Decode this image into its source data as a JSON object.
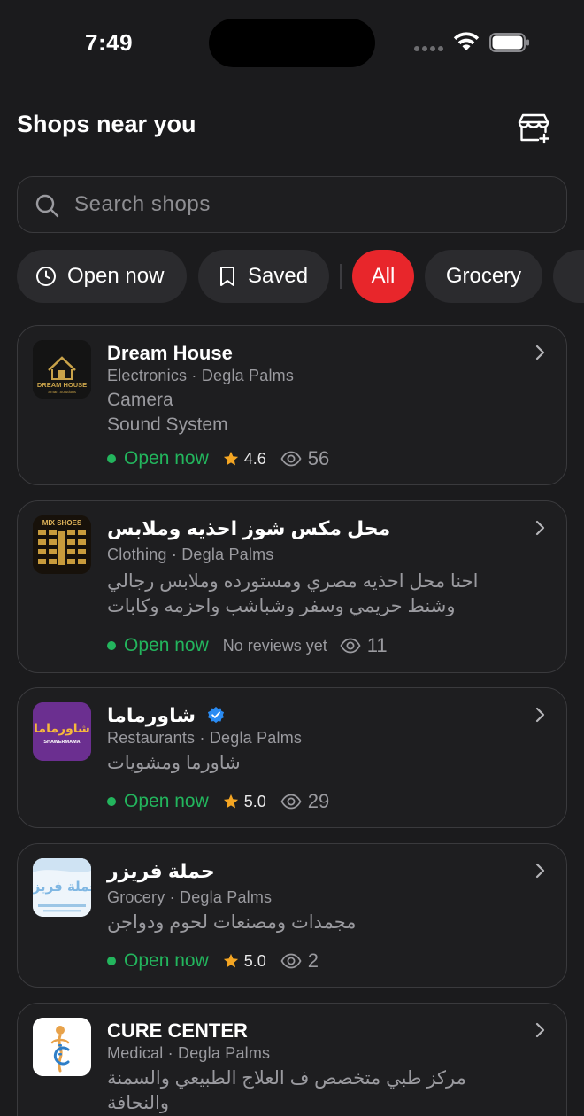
{
  "status": {
    "time": "7:49"
  },
  "header": {
    "title": "Shops near you",
    "add_icon": "store-plus-icon"
  },
  "search": {
    "placeholder": "Search shops",
    "value": ""
  },
  "filters": {
    "open_now": "Open now",
    "saved": "Saved",
    "all": "All",
    "grocery": "Grocery",
    "active": "All",
    "active_color": "#e8262b"
  },
  "shops": [
    {
      "name": "Dream House",
      "meta": "Electronics · Degla Palms",
      "desc": [
        "Camera",
        "Sound System"
      ],
      "status": "Open now",
      "rating": "4.6",
      "views": "56",
      "logo_text": "DREAM HOUSE",
      "logo_sub": "Smart Solutions"
    },
    {
      "name": "محل مكس شوز احذيه وملابس",
      "meta": "Clothing · Degla Palms",
      "desc": [
        "احنا محل احذيه مصري ومستورده وملابس رجالي",
        "وشنط حريمي وسفر وشباشب واحزمه وكابات"
      ],
      "status": "Open now",
      "rating_text": "No reviews yet",
      "views": "11",
      "logo_text": "MIX SHOES"
    },
    {
      "name": "شاورماما",
      "meta": "Restaurants · Degla Palms",
      "desc": [
        "شاورما ومشويات"
      ],
      "status": "Open now",
      "rating": "5.0",
      "views": "29",
      "verified": true,
      "logo_text": "شاورماما",
      "logo_sub": "SHAWERMAMA"
    },
    {
      "name": "حملة فريزر",
      "meta": "Grocery · Degla Palms",
      "desc": [
        "مجمدات ومصنعات لحوم ودواجن"
      ],
      "status": "Open now",
      "rating": "5.0",
      "views": "2",
      "logo_text": "حملة فريزر"
    },
    {
      "name": "CURE CENTER",
      "meta": "Medical · Degla Palms",
      "desc": [
        "مركز طبي متخصص ف العلاج الطبيعي والسمنة",
        "والنحافة"
      ]
    }
  ],
  "colors": {
    "background": "#1b1b1d",
    "card": "#1e1e20",
    "open": "#23b55d",
    "star": "#f5a623",
    "accent": "#e8262b"
  }
}
